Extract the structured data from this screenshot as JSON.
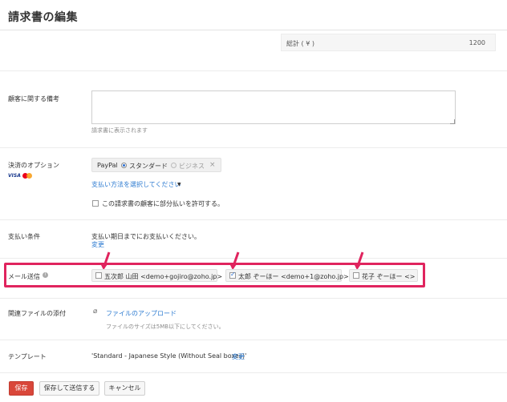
{
  "header": {
    "title": "請求書の編集"
  },
  "total": {
    "label": "総計 ( ¥ )",
    "value": "1200"
  },
  "notes": {
    "label": "顧客に関する備考",
    "value": "",
    "hint": "請求書に表示されます"
  },
  "payment": {
    "label": "決済のオプション",
    "logos": {
      "visa": "VISA",
      "mastercard": "mastercard-icon"
    },
    "provider": "PayPal",
    "options": [
      "スタンダード",
      "ビジネス"
    ],
    "selected": "スタンダード",
    "remove_icon": "×",
    "select_method_link": "支払い方法を選択してください",
    "partial_payment_label": "この請求書の顧客に部分払いを許可する。",
    "partial_payment_checked": false
  },
  "terms": {
    "label": "支払い条件",
    "text": "支払い期日までにお支払いください。",
    "change_link": "変更"
  },
  "email": {
    "label": "メール送信",
    "recipients": [
      {
        "text": "五次郎 山田 <demo+gojiro@zoho.jp>",
        "checked": false
      },
      {
        "text": "太郎 ぞーほー <demo+1@zoho.jp>",
        "checked": true
      },
      {
        "text": "花子 ぞーほー <>",
        "checked": false
      }
    ],
    "annotation_color": "#e0245e"
  },
  "attachment": {
    "label": "関連ファイルの添付",
    "upload_link": "ファイルのアップロード",
    "hint": "ファイルのサイズは5MB以下にしてください。"
  },
  "template": {
    "label": "テンプレート",
    "value": "'Standard - Japanese Style (Without Seal boxes)'",
    "change_link": "変更"
  },
  "actions": {
    "save": "保存",
    "save_send": "保存して送信する",
    "cancel": "キャンセル"
  },
  "colors": {
    "primary": "#d9473a",
    "link": "#2d7bd1"
  }
}
